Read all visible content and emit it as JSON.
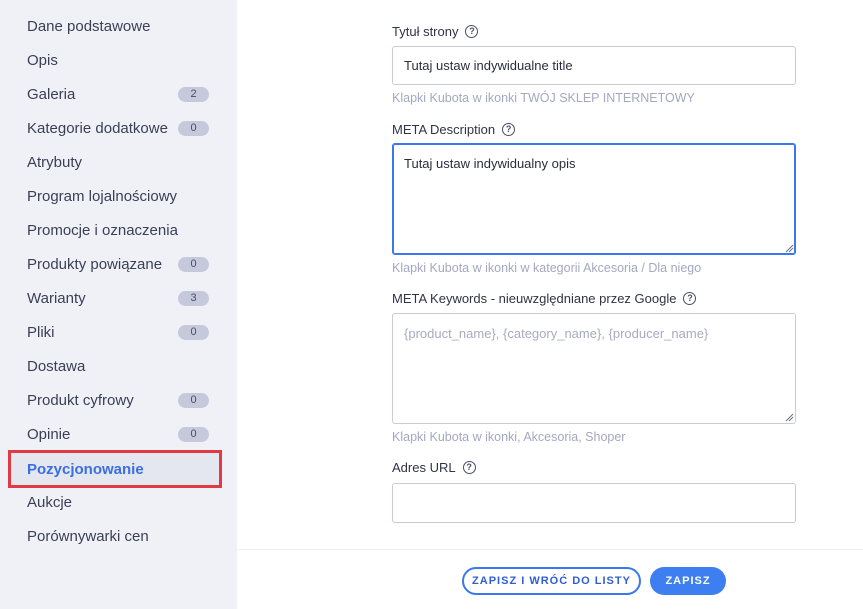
{
  "sidebar": {
    "items": [
      {
        "label": "Dane podstawowe",
        "badge": null
      },
      {
        "label": "Opis",
        "badge": null
      },
      {
        "label": "Galeria",
        "badge": "2"
      },
      {
        "label": "Kategorie dodatkowe",
        "badge": "0"
      },
      {
        "label": "Atrybuty",
        "badge": null
      },
      {
        "label": "Program lojalnościowy",
        "badge": null
      },
      {
        "label": "Promocje i oznaczenia",
        "badge": null
      },
      {
        "label": "Produkty powiązane",
        "badge": "0"
      },
      {
        "label": "Warianty",
        "badge": "3"
      },
      {
        "label": "Pliki",
        "badge": "0"
      },
      {
        "label": "Dostawa",
        "badge": null
      },
      {
        "label": "Produkt cyfrowy",
        "badge": "0"
      },
      {
        "label": "Opinie",
        "badge": "0"
      },
      {
        "label": "Pozycjonowanie",
        "badge": null,
        "active": true
      },
      {
        "label": "Aukcje",
        "badge": null
      },
      {
        "label": "Porównywarki cen",
        "badge": null
      }
    ]
  },
  "form": {
    "page_title": {
      "label": "Tytuł strony",
      "value": "Tutaj ustaw indywidualne title",
      "hint": "Klapki Kubota w ikonki TWÓJ SKLEP INTERNETOWY"
    },
    "meta_description": {
      "label": "META Description",
      "value": "Tutaj ustaw indywidualny opis",
      "hint": "Klapki Kubota w ikonki w kategorii Akcesoria / Dla niego"
    },
    "meta_keywords": {
      "label": "META Keywords - nieuwzględniane przez Google",
      "value": "",
      "placeholder": "{product_name}, {category_name}, {producer_name}",
      "hint": "Klapki Kubota w ikonki, Akcesoria, Shoper"
    },
    "url": {
      "label": "Adres URL",
      "value": ""
    },
    "help_icon_glyph": "?"
  },
  "footer": {
    "save_and_back_label": "ZAPISZ I WRÓĆ DO LISTY",
    "save_label": "ZAPISZ"
  },
  "colors": {
    "accent": "#3a78f0",
    "highlight_outline": "#e03a45",
    "sidebar_bg": "#f0f1f6"
  }
}
